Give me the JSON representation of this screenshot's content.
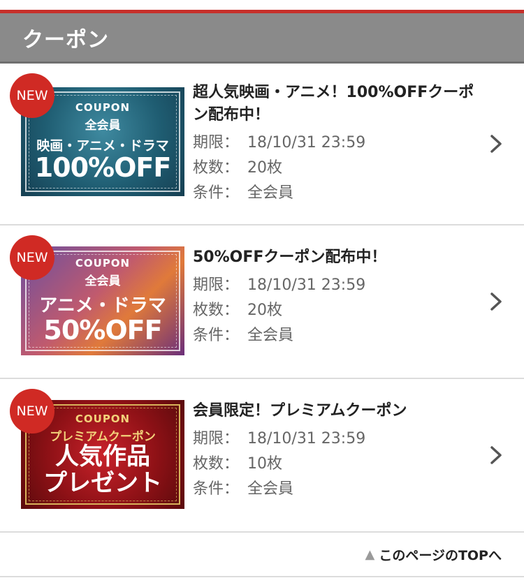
{
  "header": {
    "title": "クーポン"
  },
  "badge_label": "NEW",
  "labels": {
    "expiry": "期限：",
    "count": "枚数：",
    "condition": "条件："
  },
  "coupons": [
    {
      "title": "超人気映画・アニメ！100%OFFクーポン配布中！",
      "expiry": "18/10/31 23:59",
      "count": "20枚",
      "condition": "全会員",
      "thumb": {
        "coupon": "COUPON",
        "member": "全会員",
        "genre": "映画・アニメ・ドラマ",
        "big": "100%OFF"
      }
    },
    {
      "title": "50%OFFクーポン配布中！",
      "expiry": "18/10/31 23:59",
      "count": "20枚",
      "condition": "全会員",
      "thumb": {
        "coupon": "COUPON",
        "member": "全会員",
        "genre": "アニメ・ドラマ",
        "big": "50%OFF"
      }
    },
    {
      "title": "会員限定！プレミアムクーポン",
      "expiry": "18/10/31 23:59",
      "count": "10枚",
      "condition": "全会員",
      "thumb": {
        "coupon": "COUPON",
        "member": "プレミアムクーポン",
        "line1": "人気作品",
        "line2": "プレゼント"
      }
    }
  ],
  "footer": {
    "top_link": "このページのTOPへ"
  },
  "colors": {
    "accent_red": "#c7302a",
    "header_gray": "#8a8a8a",
    "badge_red": "#d02a24"
  }
}
